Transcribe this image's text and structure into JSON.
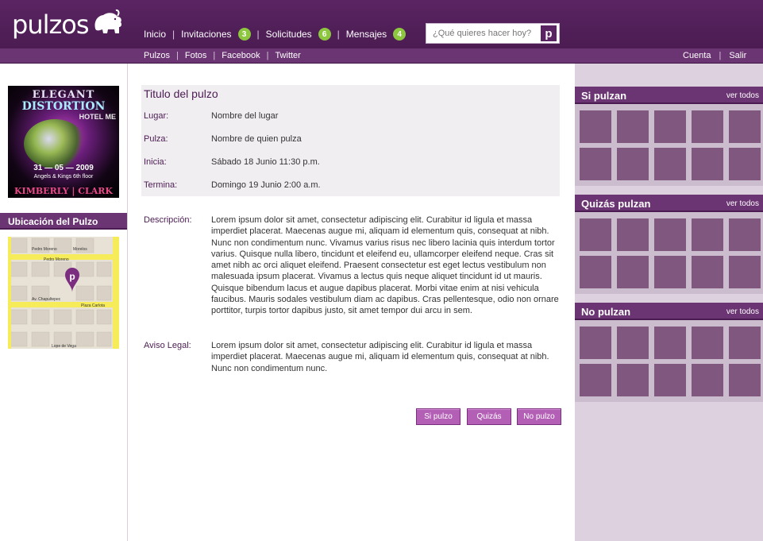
{
  "brand": {
    "name": "pulzos"
  },
  "nav": {
    "inicio": "Inicio",
    "invitaciones": "Invitaciones",
    "invitaciones_count": "3",
    "solicitudes": "Solicitudes",
    "solicitudes_count": "6",
    "mensajes": "Mensajes",
    "mensajes_count": "4",
    "separator": "|"
  },
  "search": {
    "placeholder": "¿Qué quieres hacer hoy?",
    "button_glyph": "p"
  },
  "subnav": {
    "pulzos": "Pulzos",
    "fotos": "Fotos",
    "facebook": "Facebook",
    "twitter": "Twitter",
    "cuenta": "Cuenta",
    "salir": "Salir"
  },
  "poster": {
    "line1": "ELEGANT",
    "line2": "DISTORTION",
    "line3": "HOTEL ME",
    "date": "31 — 05 — 2009",
    "venue": "Angels & Kings 6th floor",
    "names": "KIMBERLY | CLARK"
  },
  "location": {
    "title": "Ubicación del Pulzo",
    "streets": [
      "Pedro Moreno",
      "Morelos",
      "Pedro Moreno",
      "Av. Chapultepec",
      "Plaza Carlota",
      "Lope de Vega"
    ]
  },
  "event": {
    "title": "Titulo del pulzo",
    "lugar_label": "Lugar:",
    "lugar": "Nombre del lugar",
    "pulza_label": "Pulza:",
    "pulza": "Nombre de quien pulza",
    "inicia_label": "Inicia:",
    "inicia": "Sábado 18 Junio 11:30 p.m.",
    "termina_label": "Termina:",
    "termina": "Domingo 19 Junio 2:00 a.m.",
    "descripcion_label": "Descripción:",
    "descripcion": "Lorem ipsum dolor sit amet, consectetur adipiscing elit. Curabitur id ligula et massa imperdiet placerat. Maecenas augue mi, aliquam id elementum quis, consequat at nibh. Nunc non condimentum nunc. Vivamus varius risus nec libero lacinia quis interdum tortor varius. Quisque nulla libero, tincidunt et eleifend eu, ullamcorper eleifend neque. Cras sit amet nibh ac orci aliquet eleifend. Praesent consectetur est eget lectus vestibulum non malesuada ipsum placerat. Vivamus a lectus quis neque aliquet tincidunt id ut mauris. Quisque bibendum lacus et augue dapibus placerat. Morbi vitae enim at nisi vehicula faucibus. Mauris sodales vestibulum diam ac dapibus. Cras pellentesque, odio non ornare porttitor, turpis tortor dapibus justo, sit amet tempor dui arcu in sem.",
    "aviso_label": "Aviso Legal:",
    "aviso": "Lorem ipsum dolor sit amet, consectetur adipiscing elit. Curabitur id ligula et massa imperdiet placerat. Maecenas augue mi, aliquam id elementum quis, consequat at nibh. Nunc non condimentum nunc."
  },
  "actions": {
    "si": "Si pulzo",
    "quizas": "Quizás",
    "no": "No pulzo"
  },
  "sidebar": {
    "si_pulzan": "Si pulzan",
    "quizas_pulzan": "Quizás pulzan",
    "no_pulzan": "No pulzan",
    "ver_todos": "ver todos"
  },
  "colors": {
    "brand_purple": "#4b1c52",
    "bar_purple": "#6b3473",
    "badge_green": "#8dc63f",
    "button_purple": "#b25fb5",
    "thumb_purple": "#80587f"
  }
}
